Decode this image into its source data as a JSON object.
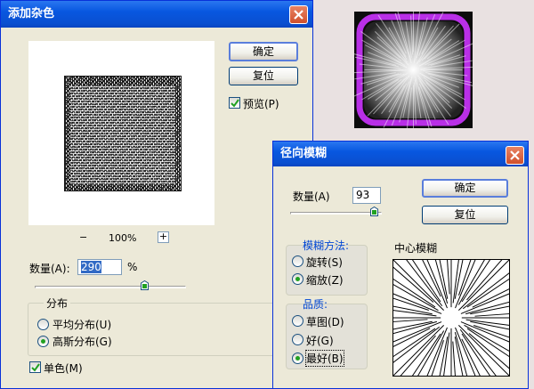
{
  "colors": {
    "titlebar_blue": "#0a4fd0",
    "dialog_bg": "#ece9d8",
    "group_label_blue": "#0046d5",
    "selection_blue": "#316ac5",
    "radio_dot_green": "#21a121",
    "close_red": "#d0502c",
    "thumbnail_glow": "#cc33ff"
  },
  "add_noise": {
    "title": "添加杂色",
    "ok_label": "确定",
    "reset_label": "复位",
    "preview_label": "预览(P)",
    "preview_checked": true,
    "zoom_minus": "−",
    "zoom_level": "100%",
    "zoom_plus": "+",
    "amount_label": "数量(A):",
    "amount_value": "290",
    "amount_unit": "%",
    "amount_slider_fraction": 0.78,
    "distribution_title": "分布",
    "distribution_options": [
      "平均分布(U)",
      "高斯分布(G)"
    ],
    "distribution_selected": 1,
    "monochrome_label": "单色(M)",
    "monochrome_checked": true
  },
  "radial_blur": {
    "title": "径向模糊",
    "amount_label": "数量(A)",
    "amount_value": "93",
    "amount_slider_fraction": 0.93,
    "ok_label": "确定",
    "reset_label": "复位",
    "method_title": "模糊方法:",
    "method_options": [
      "旋转(S)",
      "缩放(Z)"
    ],
    "method_selected": 1,
    "quality_title": "品质:",
    "quality_options": [
      "草图(D)",
      "好(G)",
      "最好(B)"
    ],
    "quality_selected": 2,
    "center_title": "中心模糊"
  },
  "icons": {
    "close": "close-icon",
    "check": "checkmark-icon"
  }
}
